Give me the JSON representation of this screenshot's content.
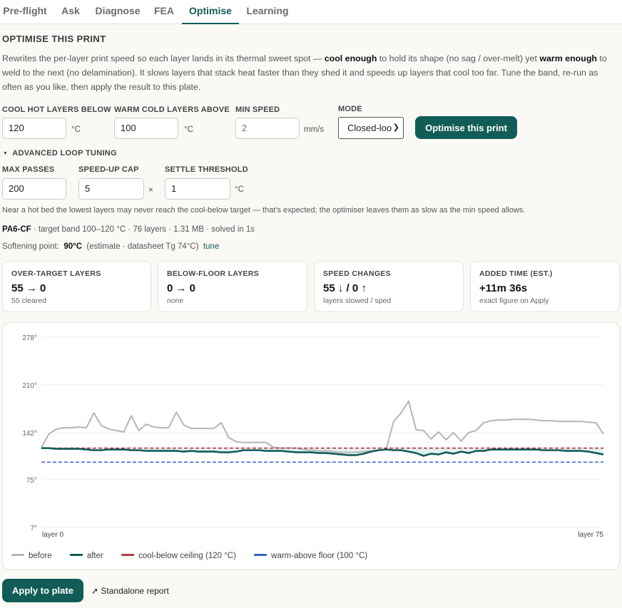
{
  "tabs": [
    {
      "label": "Pre-flight",
      "active": false
    },
    {
      "label": "Ask",
      "active": false
    },
    {
      "label": "Diagnose",
      "active": false
    },
    {
      "label": "FEA",
      "active": false
    },
    {
      "label": "Optimise",
      "active": true
    },
    {
      "label": "Learning",
      "active": false
    }
  ],
  "section_title": "OPTIMISE THIS PRINT",
  "description": {
    "p1": "Rewrites the per-layer print speed so each layer lands in its thermal sweet spot — ",
    "b1": "cool enough",
    "p2": " to hold its shape (no sag / over-melt) yet ",
    "b2": "warm enough",
    "p3": " to weld to the next (no delamination). It slows layers that stack heat faster than they shed it and speeds up layers that cool too far. Tune the band, re-run as often as you like, then apply the result to this plate."
  },
  "fields": {
    "cool_hot": {
      "label": "COOL HOT LAYERS BELOW",
      "value": "120",
      "unit": "°C"
    },
    "warm_cold": {
      "label": "WARM COLD LAYERS ABOVE",
      "value": "100",
      "unit": "°C"
    },
    "min_speed": {
      "label": "MIN SPEED",
      "value": "2",
      "unit": "mm/s"
    },
    "mode": {
      "label": "MODE",
      "value": "Closed-loop"
    }
  },
  "optimise_button": "Optimise this print",
  "advanced": {
    "toggle_label": "ADVANCED LOOP TUNING",
    "max_passes": {
      "label": "MAX PASSES",
      "value": "200"
    },
    "speedup_cap": {
      "label": "SPEED-UP CAP",
      "value": "5",
      "unit": "×"
    },
    "settle": {
      "label": "SETTLE THRESHOLD",
      "value": "1",
      "unit": "°C"
    }
  },
  "note": "Near a hot bed the lowest layers may never reach the cool-below target — that's expected; the optimiser leaves them as slow as the min speed allows.",
  "meta": {
    "material": "PA6-CF",
    "details": " · target band 100–120 °C · 76 layers · 1.31 MB · solved in 1s"
  },
  "softening": {
    "label": "Softening point:",
    "value": "90°C",
    "detail": "(estimate · datasheet Tg 74°C)",
    "link": "tune"
  },
  "cards": [
    {
      "title": "OVER-TARGET LAYERS",
      "value": "55 → 0",
      "sub": "55 cleared"
    },
    {
      "title": "BELOW-FLOOR LAYERS",
      "value": "0 → 0",
      "sub": "none"
    },
    {
      "title": "SPEED CHANGES",
      "value": "55 ↓ / 0 ↑",
      "sub": "layers slowed / sped"
    },
    {
      "title": "ADDED TIME (EST.)",
      "value": "+11m 36s",
      "sub": "exact figure on Apply"
    }
  ],
  "chart_data": {
    "type": "line",
    "x_start_label": "layer 0",
    "x_end_label": "layer 75",
    "x": [
      0,
      1,
      2,
      3,
      4,
      5,
      6,
      7,
      8,
      9,
      10,
      11,
      12,
      13,
      14,
      15,
      16,
      17,
      18,
      19,
      20,
      21,
      22,
      23,
      24,
      25,
      26,
      27,
      28,
      29,
      30,
      31,
      32,
      33,
      34,
      35,
      36,
      37,
      38,
      39,
      40,
      41,
      42,
      43,
      44,
      45,
      46,
      47,
      48,
      49,
      50,
      51,
      52,
      53,
      54,
      55,
      56,
      57,
      58,
      59,
      60,
      61,
      62,
      63,
      64,
      65,
      66,
      67,
      68,
      69,
      70,
      71,
      72,
      73,
      74,
      75
    ],
    "ylim": [
      7,
      278
    ],
    "yticks": [
      7,
      75,
      142,
      210,
      278
    ],
    "ytick_labels": [
      "7°",
      "75°",
      "142°",
      "210°",
      "278°"
    ],
    "grid": true,
    "series": [
      {
        "name": "before",
        "color": "#b5b5b5",
        "values": [
          121,
          140,
          147,
          149,
          149,
          150,
          149,
          170,
          152,
          147,
          145,
          143,
          166,
          145,
          154,
          150,
          149,
          149,
          171,
          153,
          148,
          148,
          148,
          148,
          156,
          135,
          129,
          128,
          128,
          128,
          128,
          121,
          120,
          120,
          120,
          118,
          117,
          116,
          116,
          115,
          114,
          114,
          114,
          115,
          116,
          117,
          118,
          158,
          170,
          187,
          146,
          145,
          133,
          143,
          132,
          142,
          130,
          142,
          145,
          156,
          159,
          160,
          160,
          161,
          161,
          161,
          160,
          159,
          159,
          158,
          158,
          158,
          158,
          157,
          156,
          140
        ]
      },
      {
        "name": "after",
        "color": "#125c57",
        "values": [
          120,
          120,
          119,
          119,
          119,
          119,
          118,
          117,
          117,
          118,
          118,
          118,
          117,
          117,
          116,
          116,
          116,
          116,
          116,
          115,
          116,
          115,
          115,
          115,
          114,
          114,
          115,
          117,
          117,
          117,
          116,
          116,
          116,
          115,
          114,
          114,
          114,
          113,
          113,
          112,
          111,
          110,
          110,
          112,
          115,
          117,
          118,
          117,
          117,
          115,
          113,
          109,
          112,
          111,
          114,
          112,
          115,
          113,
          116,
          116,
          118,
          118,
          118,
          118,
          118,
          118,
          118,
          117,
          117,
          117,
          116,
          116,
          116,
          115,
          113,
          111
        ]
      },
      {
        "name": "cool-below ceiling (120 °C)",
        "color": "#b03a3a",
        "dashed": true,
        "values": [
          120,
          120
        ]
      },
      {
        "name": "warm-above floor (100 °C)",
        "color": "#2c66c8",
        "dashed": true,
        "values": [
          100,
          100
        ]
      }
    ]
  },
  "legend": [
    {
      "label": "before",
      "color": "#b5b5b5"
    },
    {
      "label": "after",
      "color": "#125c57"
    },
    {
      "label": "cool-below ceiling (120 °C)",
      "color": "#b03a3a"
    },
    {
      "label": "warm-above floor (100 °C)",
      "color": "#2c66c8"
    }
  ],
  "apply_button": "Apply to plate",
  "standalone_icon": "external-link-icon",
  "standalone_label": "Standalone report"
}
